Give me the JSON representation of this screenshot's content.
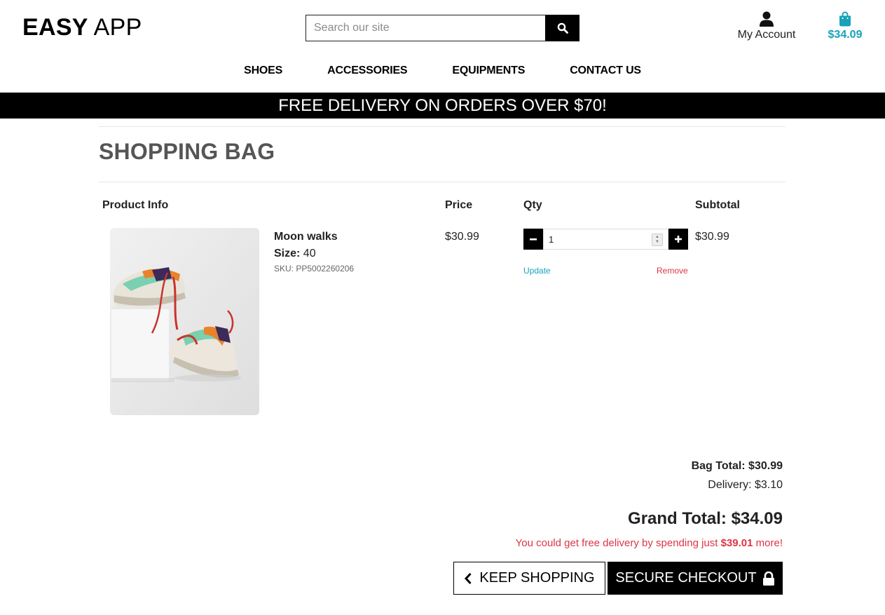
{
  "header": {
    "logo_bold": "EASY",
    "logo_rest": " APP",
    "search_placeholder": "Search our site",
    "account_label": "My Account",
    "bag_total": "$34.09"
  },
  "nav": {
    "items": [
      "SHOES",
      "ACCESSORIES",
      "EQUIPMENTS",
      "CONTACT US"
    ]
  },
  "banner": "FREE DELIVERY ON ORDERS OVER $70!",
  "page_title": "SHOPPING BAG",
  "table": {
    "headers": {
      "product": "Product Info",
      "price": "Price",
      "qty": "Qty",
      "subtotal": "Subtotal"
    }
  },
  "item": {
    "name": "Moon walks",
    "size_label": "Size:",
    "size_value": "40",
    "sku": "SKU: PP5002260206",
    "price": "$30.99",
    "qty": "1",
    "update_label": "Update",
    "remove_label": "Remove",
    "subtotal": "$30.99"
  },
  "summary": {
    "bag_total": "Bag Total: $30.99",
    "delivery": "Delivery: $3.10",
    "grand_total": "Grand Total: $34.09",
    "free_msg_before": "You could get free delivery by spending just ",
    "free_msg_amount": "$39.01",
    "free_msg_after": " more!"
  },
  "buttons": {
    "keep_shopping": "KEEP SHOPPING",
    "secure_checkout": "SECURE CHECKOUT"
  },
  "colors": {
    "accent": "#17a2b8",
    "danger": "#dc3545",
    "banner_bg": "#000000"
  },
  "icons": [
    "search-icon",
    "user-icon",
    "shopping-bag-icon",
    "minus-icon",
    "plus-icon",
    "chevron-left-icon",
    "lock-icon"
  ]
}
